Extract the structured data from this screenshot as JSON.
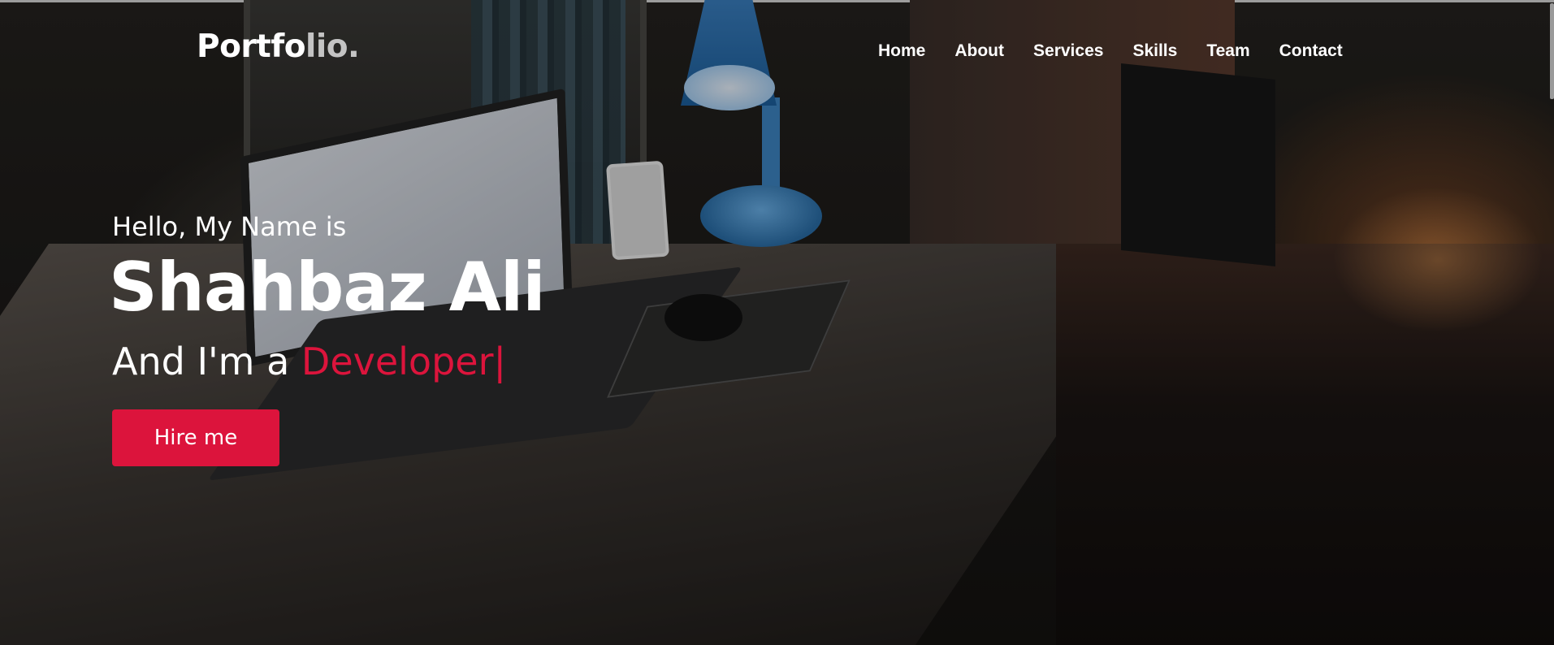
{
  "header": {
    "logo": {
      "main": "Portfo",
      "accent": "lio."
    },
    "nav": [
      {
        "label": "Home"
      },
      {
        "label": "About"
      },
      {
        "label": "Services"
      },
      {
        "label": "Skills"
      },
      {
        "label": "Team"
      },
      {
        "label": "Contact"
      }
    ]
  },
  "hero": {
    "greeting": "Hello, My Name is",
    "name": "Shahbaz Ali",
    "role_prefix": "And I'm a ",
    "role": "Developer",
    "cursor": "|",
    "cta_label": "Hire me"
  },
  "colors": {
    "accent": "#dc143c",
    "text": "#ffffff",
    "logo_accent": "#c4c4c4"
  }
}
